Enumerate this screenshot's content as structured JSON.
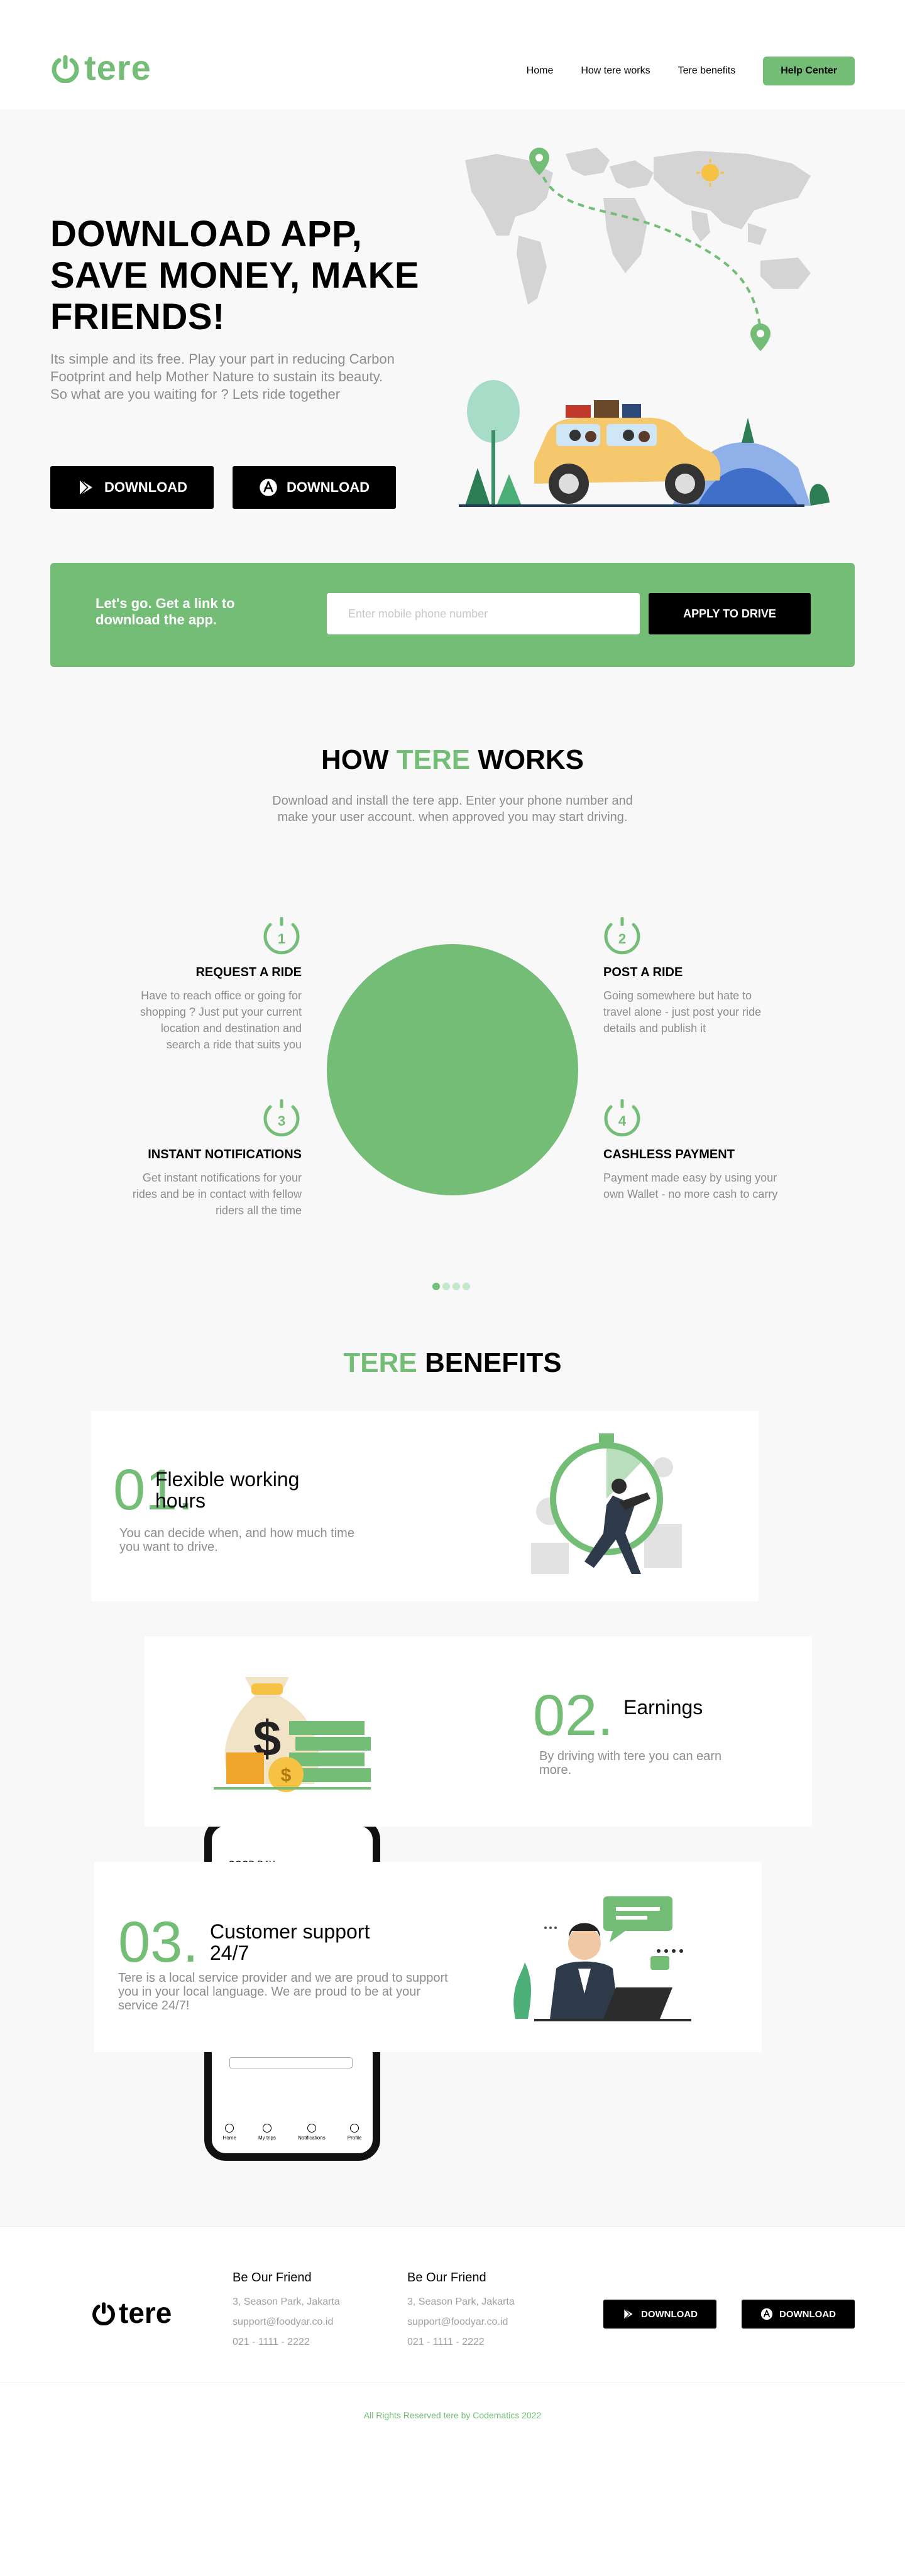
{
  "brand": {
    "name": "tere",
    "accent": "#74bd77"
  },
  "nav": {
    "items": [
      "Home",
      "How tere works",
      "Tere benefits"
    ],
    "cta": "Help Center"
  },
  "hero": {
    "title": "DOWNLOAD APP, SAVE MONEY, MAKE FRIENDS!",
    "description": "Its simple and its free. Play your part in reducing Carbon Footprint and help Mother Nature to sustain its beauty. So what are you waiting for ? Lets ride together",
    "download_google": "DOWNLOAD",
    "download_apple": "DOWNLOAD"
  },
  "banner": {
    "text": "Let's go. Get a link to download the app.",
    "placeholder": "Enter mobile phone number",
    "button": "APPLY TO DRIVE"
  },
  "how": {
    "title_pre": "HOW",
    "title_brand": "TERE",
    "title_post": "WORKS",
    "subtitle": "Download and install the tere app. Enter your phone number and make your user account. when approved you may start driving.",
    "steps": [
      {
        "num": "1",
        "title": "REQUEST A RIDE",
        "desc": "Have to reach office or going for shopping ? Just put your current location and destination and search a ride that suits you"
      },
      {
        "num": "2",
        "title": "POST A RIDE",
        "desc": "Going somewhere but hate to travel alone - just post your ride details and publish it"
      },
      {
        "num": "3",
        "title": "INSTANT NOTIFICATIONS",
        "desc": "Get instant notifications for your rides and be in contact with fellow riders all the time"
      },
      {
        "num": "4",
        "title": "CASHLESS PAYMENT",
        "desc": "Payment made easy by using your own Wallet - no more cash to carry"
      }
    ]
  },
  "benefits": {
    "title_brand": "TERE",
    "title_post": "BENEFITS",
    "items": [
      {
        "num": "01.",
        "title": "Flexible working hours",
        "desc": "You can decide when, and how much time you want to drive."
      },
      {
        "num": "02.",
        "title": "Earnings",
        "desc": "By driving with tere you can earn more."
      },
      {
        "num": "03.",
        "title": "Customer support 24/7",
        "desc": "Tere is a local service provider and we are proud to support you in your local language. We are proud to be at your service 24/7!"
      }
    ],
    "phone": {
      "greeting": "GOOD DAY,",
      "tabs": [
        "Home",
        "My trips",
        "Notifications",
        "Profile"
      ]
    }
  },
  "footer": {
    "columns": [
      {
        "title": "Be Our Friend",
        "address": "3, Season Park, Jakarta",
        "email": "support@foodyar.co.id",
        "phone": "021 - 1111 - 2222"
      },
      {
        "title": "Be Our Friend",
        "address": "3, Season Park, Jakarta",
        "email": "support@foodyar.co.id",
        "phone": "021 - 1111 - 2222"
      }
    ],
    "download_google": "DOWNLOAD",
    "download_apple": "DOWNLOAD",
    "copyright": "All Rights Reserved tere by Codematics 2022"
  }
}
